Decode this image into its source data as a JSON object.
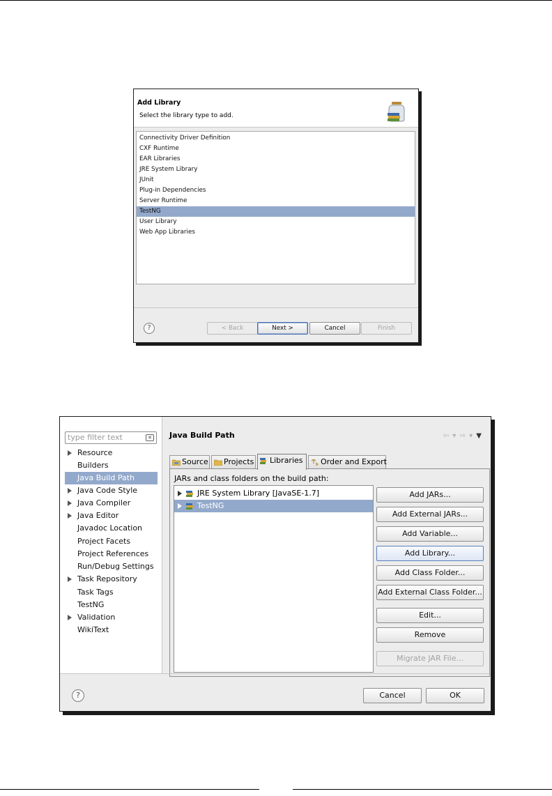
{
  "add_library": {
    "title": "Add Library",
    "subtitle": "Select the library type to add.",
    "items": [
      "Connectivity Driver Definition",
      "CXF Runtime",
      "EAR Libraries",
      "JRE System Library",
      "JUnit",
      "Plug-in Dependencies",
      "Server Runtime",
      "TestNG",
      "User Library",
      "Web App Libraries"
    ],
    "selected_item": "TestNG",
    "buttons": {
      "back": "< Back",
      "next": "Next >",
      "cancel": "Cancel",
      "finish": "Finish"
    },
    "help_icon": "question-mark-icon",
    "logo_icon": "library-jar-icon"
  },
  "build_path": {
    "filter_placeholder": "type filter text",
    "nav_items": [
      {
        "label": "Resource",
        "expandable": true
      },
      {
        "label": "Builders",
        "expandable": false
      },
      {
        "label": "Java Build Path",
        "expandable": false,
        "selected": true
      },
      {
        "label": "Java Code Style",
        "expandable": true
      },
      {
        "label": "Java Compiler",
        "expandable": true
      },
      {
        "label": "Java Editor",
        "expandable": true
      },
      {
        "label": "Javadoc Location",
        "expandable": false
      },
      {
        "label": "Project Facets",
        "expandable": false
      },
      {
        "label": "Project References",
        "expandable": false
      },
      {
        "label": "Run/Debug Settings",
        "expandable": false
      },
      {
        "label": "Task Repository",
        "expandable": true
      },
      {
        "label": "Task Tags",
        "expandable": false
      },
      {
        "label": "TestNG",
        "expandable": false
      },
      {
        "label": "Validation",
        "expandable": true
      },
      {
        "label": "WikiText",
        "expandable": false
      }
    ],
    "title": "Java Build Path",
    "tabs": [
      {
        "label": "Source",
        "icon": "source-folder-icon"
      },
      {
        "label": "Projects",
        "icon": "projects-icon"
      },
      {
        "label": "Libraries",
        "icon": "libraries-icon",
        "active": true
      },
      {
        "label": "Order and Export",
        "icon": "order-export-icon"
      }
    ],
    "panel_label": "JARs and class folders on the build path:",
    "libraries": [
      {
        "label": "JRE System Library [JavaSE-1.7]"
      },
      {
        "label": "TestNG",
        "selected": true
      }
    ],
    "buttons": [
      "Add JARs...",
      "Add External JARs...",
      "Add Variable...",
      "Add Library...",
      "Add Class Folder...",
      "Add External Class Folder...",
      "Edit...",
      "Remove",
      "Migrate JAR File..."
    ],
    "footer": {
      "cancel": "Cancel",
      "ok": "OK"
    },
    "colors": {
      "selection": "#93a9cc",
      "dialog_bg": "#ececec"
    }
  }
}
